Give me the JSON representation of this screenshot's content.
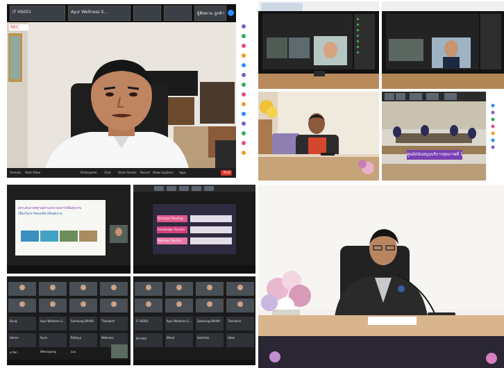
{
  "zoom_closeup": {
    "top_tiles": [
      "IT HS001",
      "Ayur Wellness S...",
      "ผู้ติดตาม ลูกค้า"
    ],
    "badge": "REC",
    "controls": [
      "Unmute",
      "Start Video",
      "Participants",
      "Chat",
      "Share Screen",
      "Record",
      "Show Captions",
      "Apps"
    ],
    "end_label": "End"
  },
  "room_meeting": {
    "banner": "ศูนย์สนับสนุนบริการสุขภาพที่ 1"
  },
  "slide_title": {
    "line1": "ยกระดับมาตรฐานสถานประกอบการเพื่อสุขภาพ",
    "line2": "เชื่อมโยงการท่องเที่ยวเชิงสุขภาพ"
  },
  "slide_items": [
    "Strategic Planning",
    "Knowledge Transfer",
    "Wellness Tourism"
  ],
  "grid_left_names": [
    "Bung",
    "Ayur Wellness S...",
    "Samsung SM-N9",
    "Thanakrit",
    "Admin",
    "Surin",
    "Pattaya",
    "Wellness",
    "อาริสา",
    "Weerapong",
    "Lux",
    "Siam"
  ],
  "grid_right_names": [
    "IT HS001",
    "Ayur Wellness S...",
    "Samsung SM-N9",
    "Thanakrit",
    "ธิดารัตน์",
    "Winai",
    "Somchai",
    "Udon",
    "Puri",
    "Chiang Mai"
  ]
}
